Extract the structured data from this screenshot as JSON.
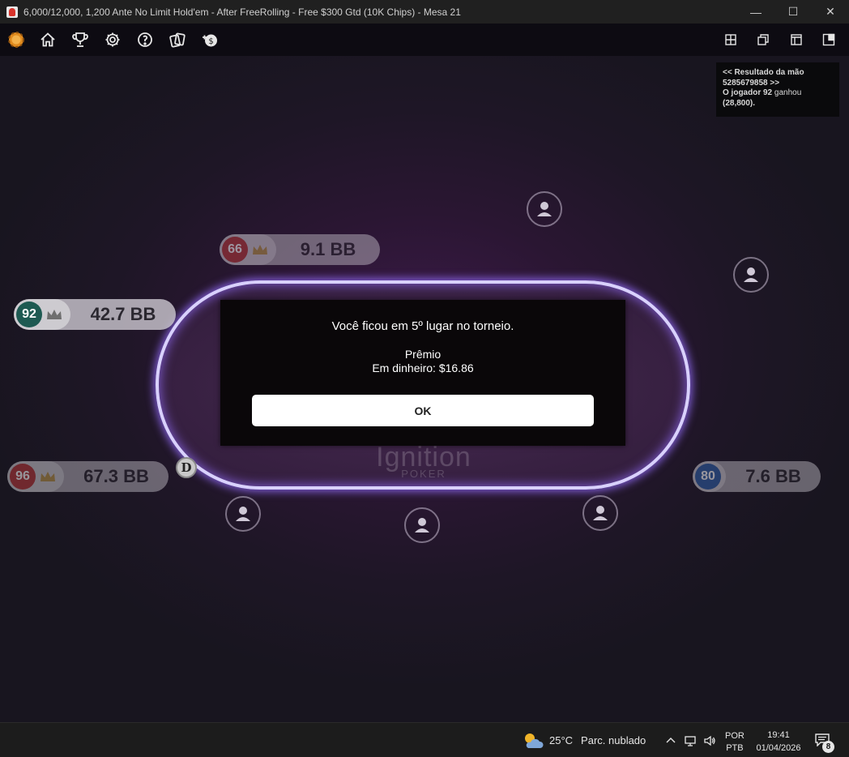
{
  "window": {
    "title": "6,000/12,000, 1,200 Ante No Limit Hold'em - After FreeRolling - Free $300 Gtd (10K Chips) - Mesa 21",
    "minimize": "—",
    "maximize": "☐",
    "close": "✕"
  },
  "toolbar": {
    "left_icons": [
      "chip-icon",
      "home-icon",
      "trophy-icon",
      "gear-icon",
      "info-icon",
      "cards-icon",
      "cashier-icon"
    ],
    "right_icons": [
      "grid-view-icon",
      "cascade-view-icon",
      "window-view-icon",
      "side-panel-icon"
    ]
  },
  "hand_result": {
    "line1": "<< Resultado da mão",
    "line2": "5285679858 >>",
    "line3_bold": "O jogador 92",
    "line3_rest": " ganhou",
    "line4": "(28,800)."
  },
  "players": [
    {
      "seat": "66",
      "stack": "9.1 BB",
      "badge_color": "#b8393a"
    },
    {
      "seat": "92",
      "stack": "42.7 BB",
      "badge_color": "#1e5a52"
    },
    {
      "seat": "96",
      "stack": "67.3 BB",
      "badge_color": "#b8393a"
    },
    {
      "seat": "80",
      "stack": "7.6 BB",
      "badge_color": "#2f5fa8"
    }
  ],
  "dealer_button": "D",
  "logo": {
    "line1": "Ignition",
    "line2": "POKER"
  },
  "dialog": {
    "message": "Você ficou em 5º lugar no torneio.",
    "prize_title": "Prêmio",
    "prize_value": "Em dinheiro: $16.86",
    "ok_label": "OK"
  },
  "taskbar": {
    "temperature": "25°C",
    "weather": "Parc. nublado",
    "lang_line1": "POR",
    "lang_line2": "PTB",
    "time": "19:41",
    "date": "01/04/2026",
    "notifications": "8"
  },
  "colors": {
    "rail": "#d9d1ff",
    "dialog_bg": "#0a0709",
    "gold_crown": "#b8954a",
    "grey_crown": "#6f6f6f"
  }
}
